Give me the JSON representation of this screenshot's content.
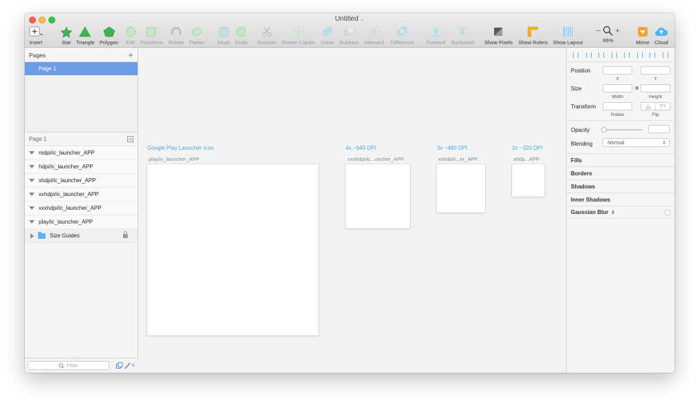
{
  "window": {
    "title": "Untitled"
  },
  "toolbar": {
    "tools": [
      {
        "label": "Insert",
        "icon": "insert-plus-icon",
        "enabled": true
      },
      {
        "label": "Star",
        "icon": "star-icon",
        "enabled": true
      },
      {
        "label": "Triangle",
        "icon": "triangle-icon",
        "enabled": true
      },
      {
        "label": "Polygon",
        "icon": "polygon-icon",
        "enabled": true
      },
      {
        "label": "Edit",
        "icon": "edit-icon",
        "enabled": false
      },
      {
        "label": "Transform",
        "icon": "transform-icon",
        "enabled": false
      },
      {
        "label": "Rotate",
        "icon": "rotate-icon",
        "enabled": false
      },
      {
        "label": "Flatten",
        "icon": "flatten-icon",
        "enabled": false
      },
      {
        "label": "Mask",
        "icon": "mask-icon",
        "enabled": false
      },
      {
        "label": "Scale",
        "icon": "scale-icon",
        "enabled": false
      },
      {
        "label": "Scissors",
        "icon": "scissors-icon",
        "enabled": false
      },
      {
        "label": "Rotate Copies",
        "icon": "rotate-copies-icon",
        "enabled": false
      },
      {
        "label": "Union",
        "icon": "union-icon",
        "enabled": false
      },
      {
        "label": "Subtract",
        "icon": "subtract-icon",
        "enabled": false
      },
      {
        "label": "Intersect",
        "icon": "intersect-icon",
        "enabled": false
      },
      {
        "label": "Difference",
        "icon": "difference-icon",
        "enabled": false
      },
      {
        "label": "Forward",
        "icon": "forward-icon",
        "enabled": false
      },
      {
        "label": "Backward",
        "icon": "backward-icon",
        "enabled": false
      },
      {
        "label": "Show Pixels",
        "icon": "show-pixels-icon",
        "enabled": true
      },
      {
        "label": "Show Rulers",
        "icon": "show-rulers-icon",
        "enabled": true
      },
      {
        "label": "Show Layout",
        "icon": "show-layout-icon",
        "enabled": true
      }
    ],
    "zoom": {
      "minus": "−",
      "plus": "+",
      "value": "66%"
    },
    "mirror_label": "Mirror",
    "cloud_label": "Cloud"
  },
  "pages": {
    "header": "Pages",
    "add": "+",
    "items": [
      "Page 1"
    ]
  },
  "layers": {
    "header": "Page 1",
    "items": [
      {
        "label": "mdpi/ic_launcher_APP",
        "type": "artboard"
      },
      {
        "label": "hdpi/ic_launcher_APP",
        "type": "artboard"
      },
      {
        "label": "xhdpi/ic_launcher_APP",
        "type": "artboard"
      },
      {
        "label": "xxhdpi/ic_launcher_APP",
        "type": "artboard"
      },
      {
        "label": "xxxhdpi/ic_launcher_APP",
        "type": "artboard"
      },
      {
        "label": "play/ic_launcher_APP",
        "type": "artboard"
      },
      {
        "label": "Size Guides",
        "type": "folder",
        "locked": true
      }
    ],
    "filter_placeholder": "Filter",
    "filter_count": "6"
  },
  "canvas": {
    "artboards": [
      {
        "group_title": "Google Play Launcher Icon",
        "name": "play/ic_launcher_APP"
      },
      {
        "group_title": "4x ~640 DPI",
        "name": "xxxhdpi/ic...uncher_APP"
      },
      {
        "group_title": "3x ~480 DPI",
        "name": "xxhdpi/i...er_APP"
      },
      {
        "group_title": "2x ~320 DPI",
        "name": "xhdp...APP"
      }
    ]
  },
  "inspector": {
    "position_label": "Position",
    "x_label": "X",
    "y_label": "Y",
    "size_label": "Size",
    "width_label": "Width",
    "height_label": "Height",
    "transform_label": "Transform",
    "rotate_label": "Rotate",
    "flip_label": "Flip",
    "opacity_label": "Opacity",
    "blending_label": "Blending",
    "blending_value": "Normal",
    "sections": [
      "Fills",
      "Borders",
      "Shadows",
      "Inner Shadows",
      "Gaussian Blur"
    ]
  },
  "colors": {
    "accent": "#4fa6e6",
    "selection": "#6b9ce6",
    "star": "#3fb34f",
    "polygon": "#3fb34f"
  }
}
